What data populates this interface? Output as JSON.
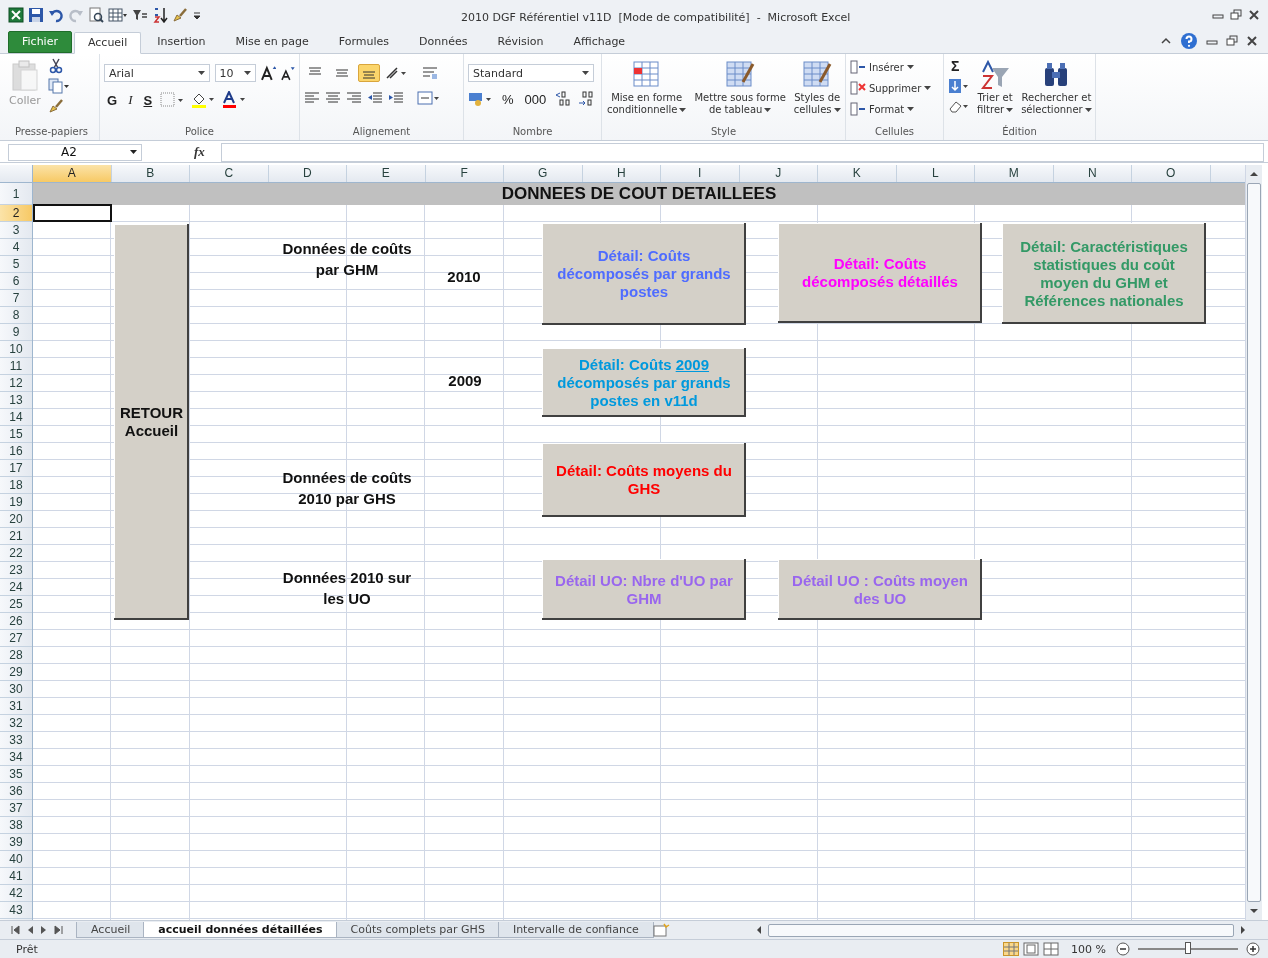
{
  "window": {
    "title": "2010 DGF Référentiel v11D  [Mode de compatibilité]  -  Microsoft Excel"
  },
  "ribbon_tabs": [
    {
      "label": "Fichier",
      "kind": "file",
      "selected": false
    },
    {
      "label": "Accueil",
      "kind": "tab",
      "selected": true
    },
    {
      "label": "Insertion",
      "kind": "tab",
      "selected": false
    },
    {
      "label": "Mise en page",
      "kind": "tab",
      "selected": false
    },
    {
      "label": "Formules",
      "kind": "tab",
      "selected": false
    },
    {
      "label": "Données",
      "kind": "tab",
      "selected": false
    },
    {
      "label": "Révision",
      "kind": "tab",
      "selected": false
    },
    {
      "label": "Affichage",
      "kind": "tab",
      "selected": false
    }
  ],
  "clipboard": {
    "paste_label": "Coller",
    "paste_disabled": true,
    "group_label": "Presse-papiers"
  },
  "font": {
    "name": "Arial",
    "size": "10",
    "bold_key": "G",
    "italic_key": "I",
    "underline_key": "S",
    "group_label": "Police"
  },
  "alignment": {
    "vertical": [
      {
        "selected": false
      },
      {
        "selected": false
      },
      {
        "selected": true
      }
    ],
    "group_label": "Alignement"
  },
  "number": {
    "format": "Standard",
    "percent": "%",
    "thousands": "000",
    "group_label": "Nombre"
  },
  "styles": {
    "buttons": [
      [
        "Mise en forme",
        "conditionnelle"
      ],
      [
        "Mettre sous forme",
        "de tableau"
      ],
      [
        "Styles de",
        "cellules"
      ]
    ],
    "group_label": "Style"
  },
  "cells": {
    "items": [
      "Insérer",
      "Supprimer",
      "Format"
    ],
    "group_label": "Cellules"
  },
  "editing": {
    "sum": "Σ",
    "sort_label": [
      "Trier et",
      "filtrer"
    ],
    "find_label": [
      "Rechercher et",
      "sélectionner"
    ],
    "group_label": "Édition"
  },
  "formula_bar": {
    "name_box": "A2",
    "function_label": "fx"
  },
  "sheet": {
    "columns": [
      {
        "label": "A",
        "selected": true
      },
      {
        "label": "B",
        "selected": false
      },
      {
        "label": "C",
        "selected": false
      },
      {
        "label": "D",
        "selected": false
      },
      {
        "label": "E",
        "selected": false
      },
      {
        "label": "F",
        "selected": false
      },
      {
        "label": "G",
        "selected": false
      },
      {
        "label": "H",
        "selected": false
      },
      {
        "label": "I",
        "selected": false
      },
      {
        "label": "J",
        "selected": false
      },
      {
        "label": "K",
        "selected": false
      },
      {
        "label": "L",
        "selected": false
      },
      {
        "label": "M",
        "selected": false
      },
      {
        "label": "N",
        "selected": false
      },
      {
        "label": "O",
        "selected": false
      }
    ],
    "rows": [
      {
        "label": "1",
        "selected": false
      },
      {
        "label": "2",
        "selected": true
      },
      {
        "label": "3",
        "selected": false
      },
      {
        "label": "4",
        "selected": false
      },
      {
        "label": "5",
        "selected": false
      },
      {
        "label": "6",
        "selected": false
      },
      {
        "label": "7",
        "selected": false
      },
      {
        "label": "8",
        "selected": false
      },
      {
        "label": "9",
        "selected": false
      },
      {
        "label": "10",
        "selected": false
      },
      {
        "label": "11",
        "selected": false
      },
      {
        "label": "12",
        "selected": false
      },
      {
        "label": "13",
        "selected": false
      },
      {
        "label": "14",
        "selected": false
      },
      {
        "label": "15",
        "selected": false
      },
      {
        "label": "16",
        "selected": false
      },
      {
        "label": "17",
        "selected": false
      },
      {
        "label": "18",
        "selected": false
      },
      {
        "label": "19",
        "selected": false
      },
      {
        "label": "20",
        "selected": false
      },
      {
        "label": "21",
        "selected": false
      },
      {
        "label": "22",
        "selected": false
      },
      {
        "label": "23",
        "selected": false
      },
      {
        "label": "24",
        "selected": false
      },
      {
        "label": "25",
        "selected": false
      },
      {
        "label": "26",
        "selected": false
      },
      {
        "label": "27",
        "selected": false
      },
      {
        "label": "28",
        "selected": false
      },
      {
        "label": "29",
        "selected": false
      },
      {
        "label": "30",
        "selected": false
      },
      {
        "label": "31",
        "selected": false
      },
      {
        "label": "32",
        "selected": false
      },
      {
        "label": "33",
        "selected": false
      },
      {
        "label": "34",
        "selected": false
      },
      {
        "label": "35",
        "selected": false
      },
      {
        "label": "36",
        "selected": false
      },
      {
        "label": "37",
        "selected": false
      },
      {
        "label": "38",
        "selected": false
      },
      {
        "label": "39",
        "selected": false
      },
      {
        "label": "40",
        "selected": false
      },
      {
        "label": "41",
        "selected": false
      },
      {
        "label": "42",
        "selected": false
      },
      {
        "label": "43",
        "selected": false
      }
    ],
    "title": "DONNEES DE COUT DETAILLEES",
    "labels": [
      "Données de coûts par GHM",
      "2010",
      "2009",
      "Données de coûts 2010 par GHS",
      "Données 2010 sur les UO"
    ],
    "back_button": "RETOUR Accueil",
    "buttons": [
      {
        "color": "#4f6cff",
        "parts": [
          {
            "text": "Détail: Coûts décomposés par grands postes",
            "underlined": false
          }
        ]
      },
      {
        "color": "#ff00ff",
        "parts": [
          {
            "text": "Détail: Coûts décomposés détaillés",
            "underlined": false
          }
        ]
      },
      {
        "color": "#339966",
        "parts": [
          {
            "text": "Détail: Caractéristiques statistiques du coût moyen du GHM et Références nationales",
            "underlined": false
          }
        ]
      },
      {
        "color": "#0099dd",
        "parts": [
          {
            "text": "Détail: Coûts ",
            "underlined": false
          },
          {
            "text": "2009",
            "underlined": true
          },
          {
            "text": " décomposés par grands postes en v11d",
            "underlined": false
          }
        ]
      },
      {
        "color": "#ff0000",
        "parts": [
          {
            "text": "Détail: Coûts moyens du GHS",
            "underlined": false
          }
        ]
      },
      {
        "color": "#9966ee",
        "parts": [
          {
            "text": "Détail UO: Nbre d'UO par GHM",
            "underlined": false
          }
        ]
      },
      {
        "color": "#9966ee",
        "parts": [
          {
            "text": "Détail UO : Coûts moyen des UO",
            "underlined": false
          }
        ]
      }
    ]
  },
  "sheet_tabs": [
    {
      "label": "Accueil",
      "selected": false
    },
    {
      "label": "accueil données détaillées",
      "selected": true
    },
    {
      "label": "Coûts complets par GHS",
      "selected": false
    },
    {
      "label": "Intervalle de confiance",
      "selected": false
    }
  ],
  "status_bar": {
    "status": "Prêt",
    "zoom": "100 %",
    "zoom_slider": {
      "level": 0.5
    }
  }
}
